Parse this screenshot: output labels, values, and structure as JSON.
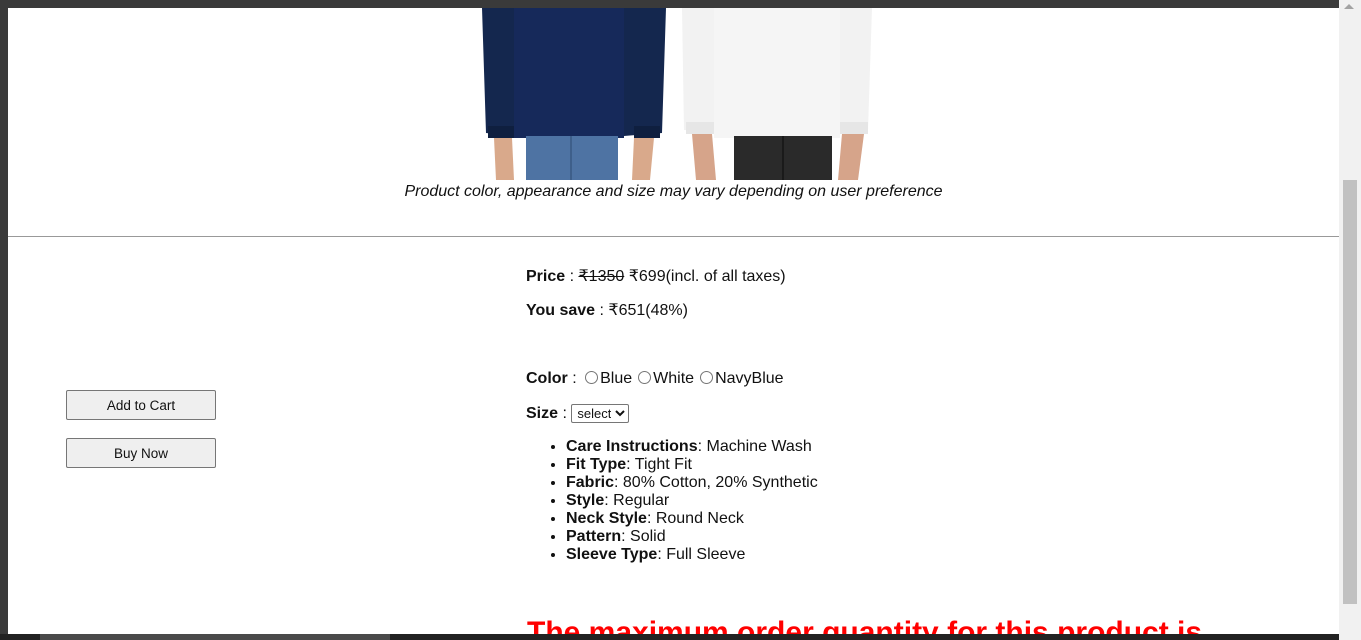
{
  "caption": "Product color, appearance and size may vary depending on user preference",
  "buttons": {
    "add_to_cart": "Add to Cart",
    "buy_now": "Buy Now"
  },
  "price": {
    "label": "Price",
    "sep": " : ",
    "original": "₹1350",
    "current": " ₹699",
    "tax_note": "(incl. of all taxes)"
  },
  "savings": {
    "label": "You save",
    "sep": " : ",
    "value": "₹651(48%)"
  },
  "color": {
    "label": "Color",
    "sep": " : ",
    "options": [
      "Blue",
      "White",
      "NavyBlue"
    ]
  },
  "size": {
    "label": "Size",
    "sep": " : ",
    "selected": "select"
  },
  "features": [
    {
      "name": "Care Instructions",
      "value": ": Machine Wash"
    },
    {
      "name": "Fit Type",
      "value": ": Tight Fit"
    },
    {
      "name": "Fabric",
      "value": ": 80% Cotton, 20% Synthetic"
    },
    {
      "name": "Style",
      "value": ": Regular"
    },
    {
      "name": "Neck Style",
      "value": ": Round Neck"
    },
    {
      "name": "Pattern",
      "value": ": Solid"
    },
    {
      "name": "Sleeve Type",
      "value": ": Full Sleeve"
    }
  ],
  "max_order_notice": "The maximum order quantity for this product is",
  "colors": {
    "navy_shirt": "#14274e",
    "white_shirt": "#f2f2f2",
    "notice": "#ff0000"
  }
}
